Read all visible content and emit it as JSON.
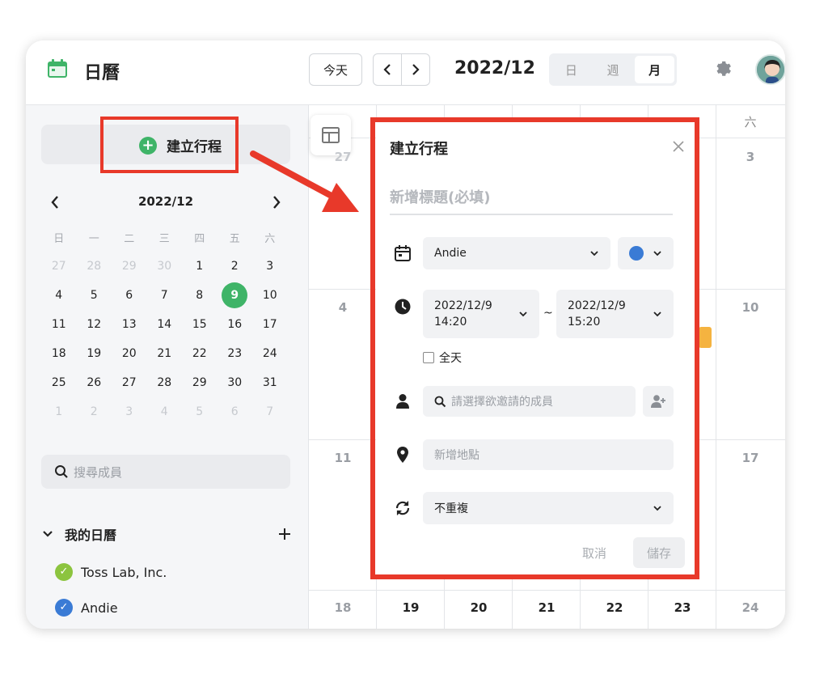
{
  "header": {
    "app_title": "日曆",
    "today_label": "今天",
    "current_month": "2022/12",
    "views": [
      {
        "label": "日",
        "active": false
      },
      {
        "label": "週",
        "active": false
      },
      {
        "label": "月",
        "active": true
      }
    ]
  },
  "sidebar": {
    "create_label": "建立行程",
    "mini_calendar": {
      "title": "2022/12",
      "weekdays": [
        "日",
        "一",
        "二",
        "三",
        "四",
        "五",
        "六"
      ],
      "weeks": [
        [
          "27",
          "28",
          "29",
          "30",
          "1",
          "2",
          "3"
        ],
        [
          "4",
          "5",
          "6",
          "7",
          "8",
          "9",
          "10"
        ],
        [
          "11",
          "12",
          "13",
          "14",
          "15",
          "16",
          "17"
        ],
        [
          "18",
          "19",
          "20",
          "21",
          "22",
          "23",
          "24"
        ],
        [
          "25",
          "26",
          "27",
          "28",
          "29",
          "30",
          "31"
        ],
        [
          "1",
          "2",
          "3",
          "4",
          "5",
          "6",
          "7"
        ]
      ],
      "selected_day": "9"
    },
    "member_search_placeholder": "搜尋成員",
    "group_label": "我的日曆",
    "calendars": [
      {
        "name": "Toss Lab, Inc.",
        "color": "#8cc43f"
      },
      {
        "name": "Andie",
        "color": "#3a7bd5"
      }
    ]
  },
  "calendar_grid": {
    "weekday_visible": [
      "六"
    ],
    "days": {
      "r0c6": "3",
      "r1c0": "4",
      "r1c6": "10",
      "r2c0": "11",
      "r2c6": "17",
      "r3": [
        "18",
        "19",
        "20",
        "21",
        "22",
        "23",
        "24"
      ],
      "r0c0": "27"
    }
  },
  "popup": {
    "title": "建立行程",
    "title_placeholder": "新增標題(必填)",
    "calendar_value": "Andie",
    "color": "#3a7bd5",
    "start_date": "2022/12/9",
    "start_time": "14:20",
    "end_date": "2022/12/9",
    "end_time": "15:20",
    "range_sep": "~",
    "all_day_label": "全天",
    "invite_placeholder": "請選擇欲邀請的成員",
    "location_placeholder": "新增地點",
    "repeat_value": "不重複",
    "cancel_label": "取消",
    "save_label": "儲存"
  },
  "colors": {
    "accent_green": "#3fb468",
    "highlight_red": "#e8392a"
  }
}
